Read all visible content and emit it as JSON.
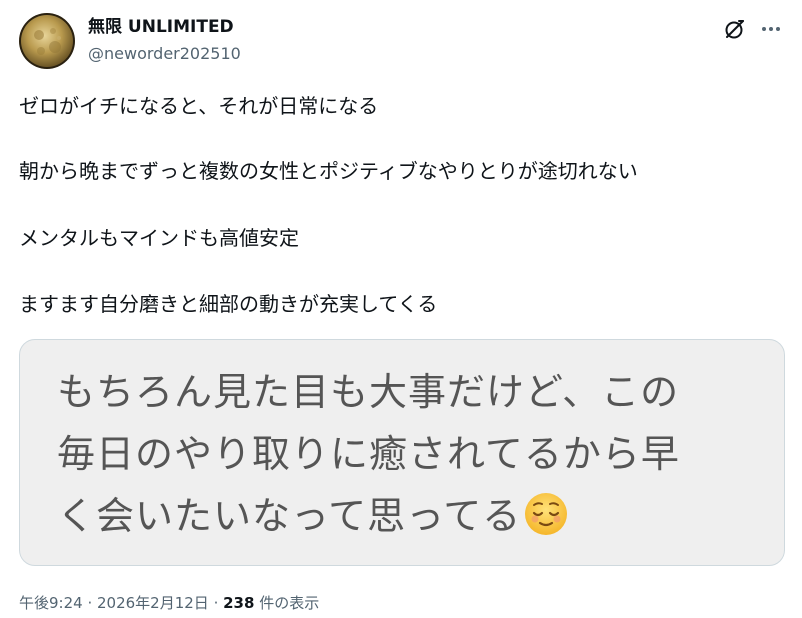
{
  "author": {
    "display_name": "無限 UNLIMITED",
    "handle": "@neworder202510",
    "avatar_icon": "moon-avatar-icon"
  },
  "header_actions": {
    "grok_icon": "grok-slash-circle-icon",
    "more_icon": "more-options-icon"
  },
  "tweet": {
    "paragraphs": [
      "ゼロがイチになると、それが日常になる",
      "朝から晩までずっと複数の女性とポジティブなやりとりが途切れない",
      "メンタルもマインドも高値安定",
      "ますます自分磨きと細部の動きが充実してくる"
    ]
  },
  "media": {
    "lines": [
      "もちろん見た目も大事だけど、この",
      "毎日のやり取りに癒されてるから早",
      "く会いたいなって思ってる"
    ],
    "emoji": "relieved-face-emoji"
  },
  "meta": {
    "time": "午後9:24",
    "separator1": " · ",
    "date": "2026年2月12日",
    "separator2": " · ",
    "views_count": "238",
    "views_label": " 件の表示"
  },
  "colors": {
    "text_primary": "#0f1419",
    "text_secondary": "#536471",
    "media_bg": "#efefef",
    "media_text": "#555555"
  }
}
